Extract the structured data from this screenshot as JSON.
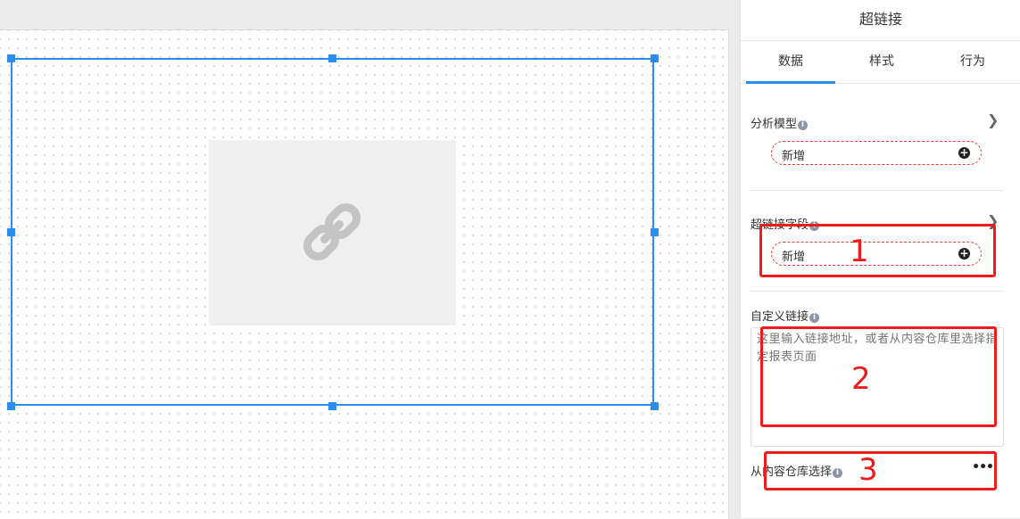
{
  "panel": {
    "title": "超链接",
    "tabs": [
      {
        "label": "数据",
        "active": true
      },
      {
        "label": "样式",
        "active": false
      },
      {
        "label": "行为",
        "active": false
      }
    ],
    "sections": {
      "analysis_model": {
        "label": "分析模型",
        "add_label": "新增"
      },
      "link_field": {
        "label": "超链接字段",
        "add_label": "新增"
      },
      "custom_link": {
        "label": "自定义链接",
        "placeholder": "这里输入链接地址，或者从内容仓库里选择指定报表页面"
      },
      "repo_select": {
        "label": "从内容仓库选择"
      }
    }
  },
  "annotations": [
    "1",
    "2",
    "3"
  ],
  "icons": {
    "info": "info-icon",
    "chevron": "chevron-right-icon",
    "plus": "plus-circle-icon",
    "more": "more-dots-icon",
    "link": "link-icon"
  },
  "colors": {
    "accent": "#2d8cf0",
    "annotation": "#ee1c1c",
    "pill_border": "#e23b3b"
  }
}
